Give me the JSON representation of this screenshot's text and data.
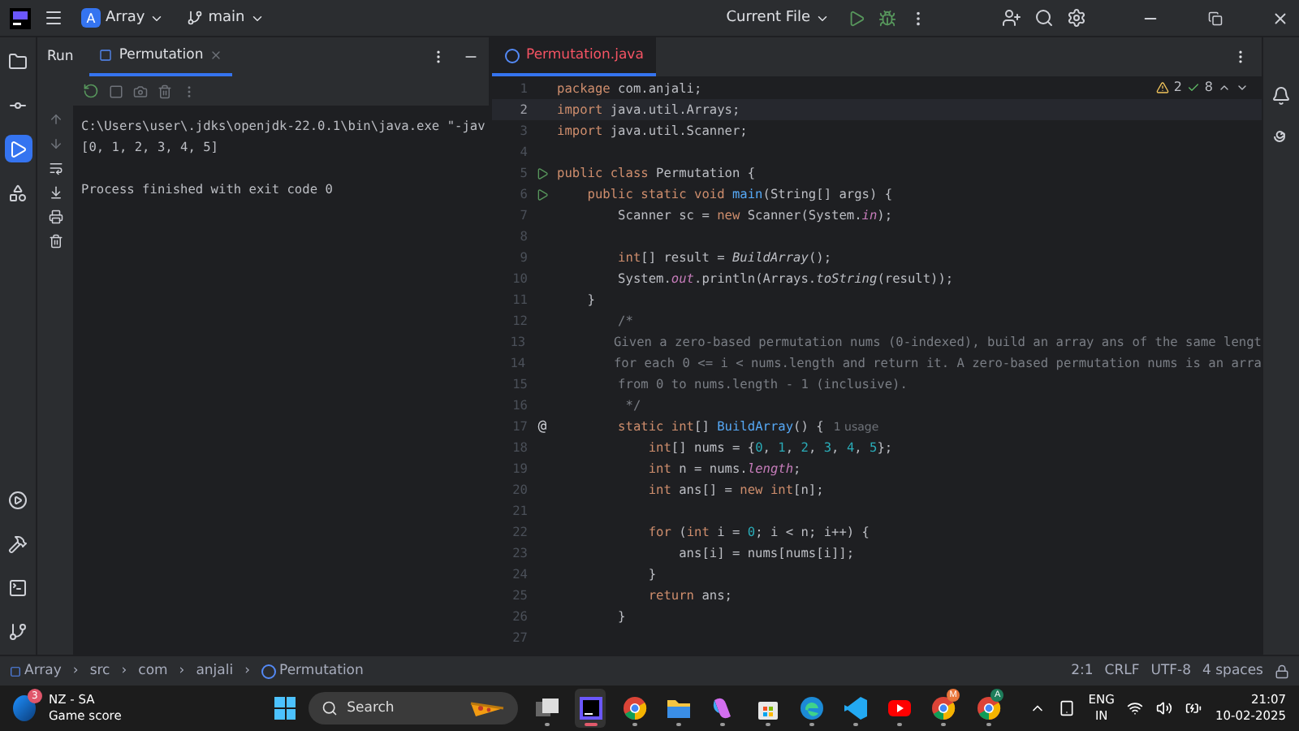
{
  "title_bar": {
    "project_initial": "A",
    "project": "Array",
    "branch": "main",
    "run_config": "Current File"
  },
  "tool_strip": {
    "top": [
      {
        "kind": "folder",
        "selected": false
      },
      {
        "kind": "commit",
        "selected": false
      },
      {
        "kind": "run",
        "selected": true
      },
      {
        "kind": "structure",
        "selected": false
      }
    ],
    "bottom": [
      {
        "kind": "services",
        "selected": false
      },
      {
        "kind": "build",
        "selected": false
      },
      {
        "kind": "terminal",
        "selected": false
      },
      {
        "kind": "git",
        "selected": false
      }
    ]
  },
  "run_panel": {
    "title": "Run",
    "tabs": [
      {
        "label": "Permutation",
        "selected": true
      }
    ],
    "console": [
      {
        "kind": "command",
        "text": "C:\\Users\\user\\.jdks\\openjdk-22.0.1\\bin\\java.exe \"-jav"
      },
      {
        "kind": "output",
        "text": "[0, 1, 2, 3, 4, 5]"
      },
      {
        "kind": "status",
        "text": "Process finished with exit code 0"
      }
    ]
  },
  "editor": {
    "tabs": [
      {
        "label": "Permutation.java",
        "selected": true,
        "error": true
      }
    ],
    "inspections": {
      "warnings": "2",
      "checks": "8"
    },
    "lines": [
      {
        "number": "1",
        "current": false,
        "tokens": [
          {
            "kind": "kw",
            "t": "package"
          },
          {
            "kind": "plain",
            "t": " com.anjali;"
          }
        ]
      },
      {
        "number": "2",
        "current": true,
        "tokens": [
          {
            "kind": "kw",
            "t": "import"
          },
          {
            "kind": "plain",
            "t": " java.util.Arrays;"
          }
        ]
      },
      {
        "number": "3",
        "current": false,
        "tokens": [
          {
            "kind": "kw",
            "t": "import"
          },
          {
            "kind": "plain",
            "t": " java.util.Scanner;"
          }
        ]
      },
      {
        "number": "4",
        "current": false
      },
      {
        "number": "5",
        "current": false,
        "gutter": {
          "kind": "run"
        },
        "tokens": [
          {
            "kind": "kw",
            "t": "public class"
          },
          {
            "kind": "plain",
            "t": " Permutation {"
          }
        ]
      },
      {
        "number": "6",
        "current": false,
        "gutter": {
          "kind": "run"
        },
        "tokens": [
          {
            "kind": "kw",
            "t": "    public static void"
          },
          {
            "kind": "method",
            "t": " main"
          },
          {
            "kind": "plain",
            "t": "(String[] args) {"
          }
        ]
      },
      {
        "number": "7",
        "current": false,
        "tokens": [
          {
            "kind": "plain",
            "t": "        Scanner sc = "
          },
          {
            "kind": "kw",
            "t": "new"
          },
          {
            "kind": "plain",
            "t": " Scanner(System."
          },
          {
            "kind": "field",
            "t": "in"
          },
          {
            "kind": "plain",
            "t": ");"
          }
        ]
      },
      {
        "number": "8",
        "current": false
      },
      {
        "number": "9",
        "current": false,
        "tokens": [
          {
            "kind": "kw",
            "t": "        int"
          },
          {
            "kind": "plain",
            "t": "[] result = "
          },
          {
            "kind": "static",
            "t": "BuildArray"
          },
          {
            "kind": "plain",
            "t": "();"
          }
        ]
      },
      {
        "number": "10",
        "current": false,
        "tokens": [
          {
            "kind": "plain",
            "t": "        System."
          },
          {
            "kind": "field",
            "t": "out"
          },
          {
            "kind": "plain",
            "t": ".println(Arrays."
          },
          {
            "kind": "static",
            "t": "toString"
          },
          {
            "kind": "plain",
            "t": "(result));"
          }
        ]
      },
      {
        "number": "11",
        "current": false,
        "tokens": [
          {
            "kind": "plain",
            "t": "    }"
          }
        ]
      },
      {
        "number": "12",
        "current": false,
        "tokens": [
          {
            "kind": "comment",
            "t": "        /*"
          }
        ]
      },
      {
        "number": "13",
        "current": false,
        "tokens": [
          {
            "kind": "comment",
            "t": "        Given a zero-based permutation nums (0-indexed), build an array ans of the same lengt"
          }
        ]
      },
      {
        "number": "14",
        "current": false,
        "tokens": [
          {
            "kind": "comment",
            "t": "        for each 0 <= i < nums.length and return it. A zero-based permutation nums is an arra"
          }
        ]
      },
      {
        "number": "15",
        "current": false,
        "tokens": [
          {
            "kind": "comment",
            "t": "        from 0 to nums.length - 1 (inclusive)."
          }
        ]
      },
      {
        "number": "16",
        "current": false,
        "tokens": [
          {
            "kind": "comment",
            "t": "         */"
          }
        ]
      },
      {
        "number": "17",
        "current": false,
        "gutter": {
          "kind": "text",
          "text": "@"
        },
        "tokens": [
          {
            "kind": "kw",
            "t": "        static int"
          },
          {
            "kind": "plain",
            "t": "[] "
          },
          {
            "kind": "method",
            "t": "BuildArray"
          },
          {
            "kind": "plain",
            "t": "() {"
          },
          {
            "kind": "hint",
            "t": "1 usage"
          }
        ]
      },
      {
        "number": "18",
        "current": false,
        "tokens": [
          {
            "kind": "kw",
            "t": "            int"
          },
          {
            "kind": "plain",
            "t": "[] nums = {"
          },
          {
            "kind": "num",
            "t": "0"
          },
          {
            "kind": "plain",
            "t": ", "
          },
          {
            "kind": "num",
            "t": "1"
          },
          {
            "kind": "plain",
            "t": ", "
          },
          {
            "kind": "num",
            "t": "2"
          },
          {
            "kind": "plain",
            "t": ", "
          },
          {
            "kind": "num",
            "t": "3"
          },
          {
            "kind": "plain",
            "t": ", "
          },
          {
            "kind": "num",
            "t": "4"
          },
          {
            "kind": "plain",
            "t": ", "
          },
          {
            "kind": "num",
            "t": "5"
          },
          {
            "kind": "plain",
            "t": "};"
          }
        ]
      },
      {
        "number": "19",
        "current": false,
        "tokens": [
          {
            "kind": "kw",
            "t": "            int"
          },
          {
            "kind": "plain",
            "t": " n = nums."
          },
          {
            "kind": "field",
            "t": "length"
          },
          {
            "kind": "plain",
            "t": ";"
          }
        ]
      },
      {
        "number": "20",
        "current": false,
        "tokens": [
          {
            "kind": "kw",
            "t": "            int"
          },
          {
            "kind": "plain",
            "t": " ans[] = "
          },
          {
            "kind": "kw",
            "t": "new int"
          },
          {
            "kind": "plain",
            "t": "[n];"
          }
        ]
      },
      {
        "number": "21",
        "current": false
      },
      {
        "number": "22",
        "current": false,
        "tokens": [
          {
            "kind": "kw",
            "t": "            for"
          },
          {
            "kind": "plain",
            "t": " ("
          },
          {
            "kind": "kw",
            "t": "int"
          },
          {
            "kind": "plain",
            "t": " i = "
          },
          {
            "kind": "num",
            "t": "0"
          },
          {
            "kind": "plain",
            "t": "; i < n; i++) {"
          }
        ]
      },
      {
        "number": "23",
        "current": false,
        "tokens": [
          {
            "kind": "plain",
            "t": "                ans[i] = nums[nums[i]];"
          }
        ]
      },
      {
        "number": "24",
        "current": false,
        "tokens": [
          {
            "kind": "plain",
            "t": "            }"
          }
        ]
      },
      {
        "number": "25",
        "current": false,
        "tokens": [
          {
            "kind": "kw",
            "t": "            return"
          },
          {
            "kind": "plain",
            "t": " ans;"
          }
        ]
      },
      {
        "number": "26",
        "current": false,
        "tokens": [
          {
            "kind": "plain",
            "t": "        }"
          }
        ]
      },
      {
        "number": "27",
        "current": false
      }
    ]
  },
  "status_bar": {
    "breadcrumbs": [
      {
        "kind": "module",
        "label": "Array"
      },
      {
        "kind": "folder",
        "label": "src"
      },
      {
        "kind": "folder",
        "label": "com"
      },
      {
        "kind": "folder",
        "label": "anjali"
      },
      {
        "kind": "class",
        "label": "Permutation"
      }
    ],
    "separator": "›",
    "position": "2:1",
    "line_ending": "CRLF",
    "encoding": "UTF-8",
    "indent": "4 spaces"
  },
  "taskbar": {
    "weather": {
      "badge": "3",
      "title": "NZ - SA",
      "subtitle": "Game score"
    },
    "search": {
      "placeholder": "Search"
    },
    "apps": [
      {
        "kind": "taskview",
        "active": false
      },
      {
        "kind": "ide",
        "active": true
      },
      {
        "kind": "chrome",
        "active": false
      },
      {
        "kind": "files",
        "active": false
      },
      {
        "kind": "copilot",
        "active": false
      },
      {
        "kind": "store",
        "active": false
      },
      {
        "kind": "edge",
        "active": false
      },
      {
        "kind": "vscode",
        "active": false
      },
      {
        "kind": "youtube",
        "active": false
      },
      {
        "kind": "chrome",
        "active": false,
        "badge": "M"
      },
      {
        "kind": "chrome",
        "active": false,
        "badge": "A"
      }
    ],
    "tray": {
      "language": "ENG",
      "region": "IN",
      "time": "21:07",
      "date": "10-02-2025"
    }
  }
}
